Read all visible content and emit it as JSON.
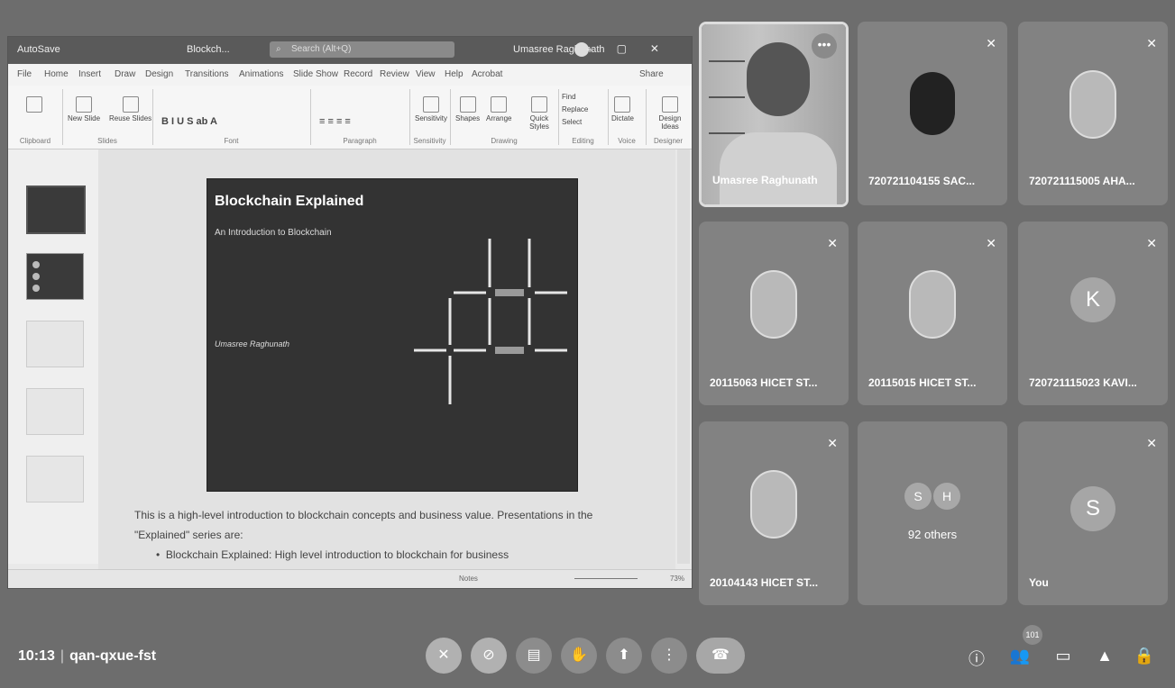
{
  "ppt": {
    "autosave": "AutoSave",
    "file_name": "Blockch...",
    "search_placeholder": "Search (Alt+Q)",
    "user_name": "Umasree Raghunath",
    "menu": [
      "File",
      "Home",
      "Insert",
      "Draw",
      "Design",
      "Transitions",
      "Animations",
      "Slide Show",
      "Record",
      "Review",
      "View",
      "Help",
      "Acrobat",
      "Share"
    ],
    "share_label": "Share",
    "ribbon_groups": [
      "Clipboard",
      "Slides",
      "Font",
      "Paragraph",
      "Sensitivity",
      "Drawing",
      "Editing",
      "Voice",
      "Designer"
    ],
    "ribbon_buttons": {
      "new_slide": "New Slide",
      "reuse": "Reuse Slides",
      "sensitivity": "Sensitivity",
      "shapes": "Shapes",
      "arrange": "Arrange",
      "quick_styles": "Quick Styles",
      "find": "Find",
      "replace": "Replace",
      "select": "Select",
      "dictate": "Dictate",
      "design_ideas": "Design Ideas"
    },
    "slide": {
      "title": "Blockchain Explained",
      "subtitle": "An Introduction to Blockchain",
      "author": "Umasree Raghunath"
    },
    "notes": {
      "line1": "This is a high-level introduction to blockchain concepts and business value. Presentations in the",
      "line2": "\"Explained\" series are:",
      "bullet": "Blockchain Explained: High level introduction to blockchain for business"
    },
    "status": {
      "notes": "Notes",
      "zoom": "73%"
    }
  },
  "participants": [
    {
      "name": "Umasree Raghunath",
      "type": "video"
    },
    {
      "name": "720721104155 SAC...",
      "type": "dark",
      "muted": true
    },
    {
      "name": "720721115005 AHA...",
      "type": "photo",
      "muted": true
    },
    {
      "name": "20115063 HICET ST...",
      "type": "photo",
      "muted": true
    },
    {
      "name": "20115015 HICET ST...",
      "type": "photo",
      "muted": true
    },
    {
      "name": "720721115023 KAVI...",
      "type": "letter",
      "letter": "K",
      "muted": true
    },
    {
      "name": "20104143 HICET ST...",
      "type": "photo",
      "muted": true
    },
    {
      "name": "92 others",
      "type": "group",
      "letters": [
        "S",
        "H"
      ]
    },
    {
      "name": "You",
      "type": "letter",
      "letter": "S",
      "muted": true
    }
  ],
  "meeting": {
    "time": "10:13",
    "code": "qan-qxue-fst",
    "participant_count": "101"
  },
  "colors": {
    "background": "#6d6d6d",
    "tile": "#828282",
    "slide_bg": "#333333"
  }
}
